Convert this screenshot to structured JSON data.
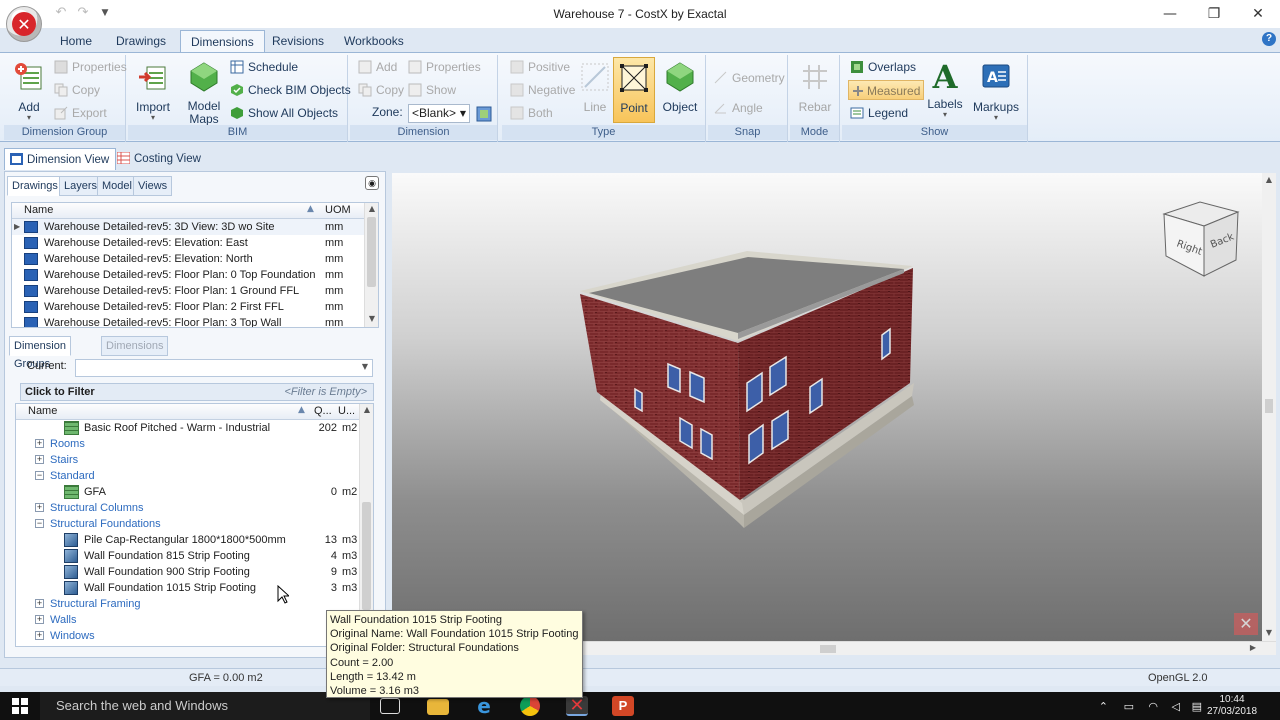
{
  "window": {
    "title": "Warehouse 7 - CostX by Exactal",
    "minimize": "—",
    "maximize": "❐",
    "close": "✕"
  },
  "ribbon_tabs": [
    "Home",
    "Drawings",
    "Dimensions",
    "Revisions",
    "Workbooks"
  ],
  "ribbon": {
    "dimension_group": {
      "label": "Dimension Group",
      "add": "Add",
      "properties": "Properties",
      "copy": "Copy",
      "export": "Export"
    },
    "bim": {
      "label": "BIM",
      "import": "Import",
      "model_maps_1": "Model",
      "model_maps_2": "Maps",
      "schedule": "Schedule",
      "check_bim": "Check BIM Objects",
      "show_all": "Show All Objects"
    },
    "dimension": {
      "label": "Dimension",
      "add": "Add",
      "properties": "Properties",
      "copy": "Copy",
      "show": "Show",
      "zone_label": "Zone:",
      "zone_value": "<Blank>"
    },
    "type": {
      "label": "Type",
      "positive": "Positive",
      "negative": "Negative",
      "both": "Both",
      "line": "Line",
      "point": "Point",
      "object": "Object"
    },
    "snap": {
      "label": "Snap",
      "geometry": "Geometry",
      "angle": "Angle"
    },
    "mode": {
      "label": "Mode",
      "rebar": "Rebar"
    },
    "show": {
      "label": "Show",
      "overlaps": "Overlaps",
      "measured": "Measured",
      "legend": "Legend",
      "labels": "Labels",
      "markups": "Markups"
    }
  },
  "view_tabs": [
    "Dimension View",
    "Costing View"
  ],
  "drawings_panel": {
    "tabs": [
      "Drawings",
      "Layers",
      "Model",
      "Views"
    ],
    "columns": {
      "name": "Name",
      "uom": "UOM"
    },
    "rows": [
      {
        "name": "Warehouse Detailed-rev5: 3D View: 3D wo Site",
        "uom": "mm"
      },
      {
        "name": "Warehouse Detailed-rev5: Elevation: East",
        "uom": "mm"
      },
      {
        "name": "Warehouse Detailed-rev5: Elevation: North",
        "uom": "mm"
      },
      {
        "name": "Warehouse Detailed-rev5: Floor Plan: 0 Top Foundation",
        "uom": "mm"
      },
      {
        "name": "Warehouse Detailed-rev5: Floor Plan: 1 Ground FFL",
        "uom": "mm"
      },
      {
        "name": "Warehouse Detailed-rev5: Floor Plan: 2 First FFL",
        "uom": "mm"
      },
      {
        "name": "Warehouse Detailed-rev5: Floor Plan: 3 Top Wall",
        "uom": "mm"
      }
    ]
  },
  "groups_panel": {
    "tabs": [
      "Dimension Groups",
      "Dimensions"
    ],
    "current_label": "Current:",
    "filter_label": "Click to Filter",
    "filter_status": "<Filter is Empty>",
    "columns": {
      "name": "Name",
      "qty": "Q...",
      "unit": "U..."
    },
    "rows": [
      {
        "kind": "item",
        "icon": "grid",
        "name": "Basic Roof Pitched - Warm - Industrial",
        "qty": "202",
        "unit": "m2"
      },
      {
        "kind": "folder",
        "exp": "+",
        "name": "Rooms"
      },
      {
        "kind": "folder",
        "exp": "+",
        "name": "Stairs"
      },
      {
        "kind": "folder",
        "exp": "−",
        "name": "Standard"
      },
      {
        "kind": "item",
        "icon": "grid",
        "name": "GFA",
        "qty": "0",
        "unit": "m2"
      },
      {
        "kind": "folder",
        "exp": "+",
        "name": "Structural Columns"
      },
      {
        "kind": "folder",
        "exp": "−",
        "name": "Structural Foundations"
      },
      {
        "kind": "item",
        "icon": "box",
        "name": "Pile Cap-Rectangular 1800*1800*500mm",
        "qty": "13",
        "unit": "m3"
      },
      {
        "kind": "item",
        "icon": "box",
        "name": "Wall Foundation 815 Strip Footing",
        "qty": "4",
        "unit": "m3"
      },
      {
        "kind": "item",
        "icon": "box",
        "name": "Wall Foundation 900 Strip Footing",
        "qty": "9",
        "unit": "m3"
      },
      {
        "kind": "item",
        "icon": "box",
        "name": "Wall Foundation 1015 Strip Footing",
        "qty": "3",
        "unit": "m3"
      },
      {
        "kind": "folder",
        "exp": "+",
        "name": "Structural Framing"
      },
      {
        "kind": "folder",
        "exp": "+",
        "name": "Walls"
      },
      {
        "kind": "folder",
        "exp": "+",
        "name": "Windows"
      }
    ]
  },
  "tooltip": [
    "Wall Foundation 1015 Strip Footing",
    "Original Name: Wall Foundation 1015 Strip Footing",
    "Original Folder: Structural Foundations",
    "Count = 2.00",
    "Length = 13.42 m",
    "Volume = 3.16 m3"
  ],
  "status": {
    "gfa": "GFA = 0.00 m2",
    "renderer": "OpenGL 2.0"
  },
  "viewcube": {
    "right": "Right",
    "back": "Back"
  },
  "taskbar": {
    "search": "Search the web and Windows",
    "time": "10:44",
    "date": "27/03/2018"
  }
}
